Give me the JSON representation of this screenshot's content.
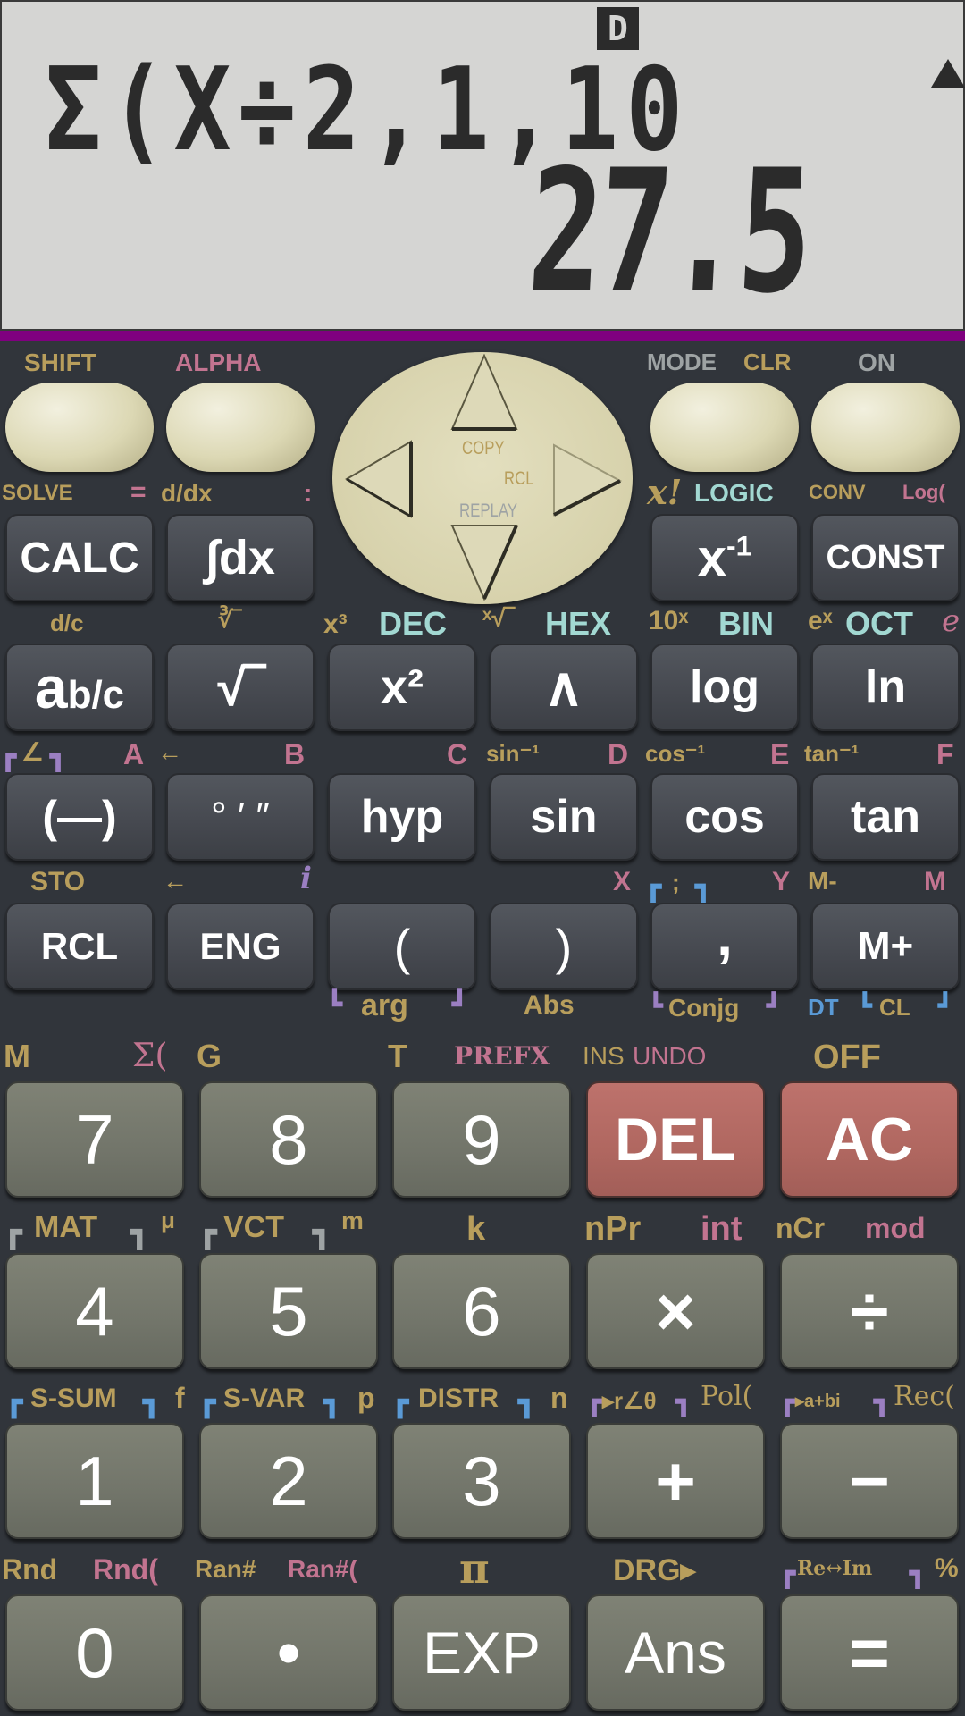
{
  "display": {
    "angle_mode_indicator": "D",
    "scroll_indicator": "up-triangle-icon",
    "expression": "Σ(X÷2,1,10",
    "result": "27.5"
  },
  "colors": {
    "body": "#31353b",
    "display_bg": "#d5d5d3",
    "display_border_bar": "#7f007f",
    "shift_label": "#b89e5c",
    "alpha_label": "#c27490",
    "mode_label": "#9ea3a4",
    "base_n_label": "#a2d8d2",
    "stat_bracket": "#5a9ad6",
    "complex_bracket": "#9b7fc2",
    "function_key": "#4a4d54",
    "number_key": "#74776b",
    "red_key": "#b06760"
  },
  "top_row": {
    "shift": {
      "label": "SHIFT"
    },
    "alpha": {
      "label": "ALPHA"
    },
    "mode": {
      "label": "MODE",
      "shift_label": "CLR"
    },
    "on": {
      "label": "ON"
    },
    "dpad": {
      "copy": "COPY",
      "rcl": "RCL",
      "replay": "REPLAY"
    }
  },
  "row2": {
    "labels": {
      "solve": "SOLVE",
      "eq": "=",
      "ddx": "d/dx",
      "colon": ":",
      "xfact": "x!",
      "logic": "LOGIC",
      "conv": "CONV",
      "logb": "Log("
    },
    "keys": {
      "calc": "CALC",
      "integral": "∫dx",
      "inverse": "x",
      "inverse_sup": "-1",
      "const": "CONST"
    }
  },
  "row3": {
    "labels": {
      "dc": "d/c",
      "cbrt": "∛‾",
      "x3": "x³",
      "dec": "DEC",
      "xroot": "ˣ√‾",
      "hex": "HEX",
      "tenx": "10ˣ",
      "bin": "BIN",
      "ex": "eˣ",
      "oct": "OCT",
      "e": "e"
    },
    "keys": {
      "frac": "ab/c",
      "frac_a": "a",
      "frac_bc": "b/c",
      "sqrt": "√‾",
      "square": "x²",
      "power": "∧",
      "log": "log",
      "ln": "ln"
    }
  },
  "row4": {
    "labels": {
      "angle": "∠",
      "A": "A",
      "left_arrow": "←",
      "B": "B",
      "C": "C",
      "asin": "sin⁻¹",
      "D": "D",
      "acos": "cos⁻¹",
      "E": "E",
      "atan": "tan⁻¹",
      "F": "F"
    },
    "keys": {
      "neg": "(—)",
      "dms": "° ′ ″",
      "hyp": "hyp",
      "sin": "sin",
      "cos": "cos",
      "tan": "tan"
    }
  },
  "row5": {
    "labels": {
      "sto": "STO",
      "left_arrow": "←",
      "i": "i",
      "X": "X",
      "semicolon": ";",
      "Y": "Y",
      "mminus": "M-",
      "M": "M",
      "arg": "arg",
      "abs": "Abs",
      "conjg": "Conjg",
      "dt": "DT",
      "cl": "CL"
    },
    "keys": {
      "rcl": "RCL",
      "eng": "ENG",
      "lparen": "(",
      "rparen": ")",
      "comma": ",",
      "mplus": "M+"
    }
  },
  "row6": {
    "labels": {
      "M": "M",
      "sigma": "Σ(",
      "G": "G",
      "T": "T",
      "prefx": "PREFX",
      "ins": "INS",
      "undo": "UNDO",
      "off": "OFF"
    },
    "keys": [
      "7",
      "8",
      "9",
      "DEL",
      "AC"
    ]
  },
  "row7": {
    "labels": {
      "mat": "MAT",
      "mu": "μ",
      "vct": "VCT",
      "m": "m",
      "k": "k",
      "npr": "nPr",
      "int": "int",
      "ncr": "nCr",
      "mod": "mod"
    },
    "keys": [
      "4",
      "5",
      "6",
      "×",
      "÷"
    ]
  },
  "row8": {
    "labels": {
      "ssum": "S-SUM",
      "f": "f",
      "svar": "S-VAR",
      "p": "p",
      "distr": "DISTR",
      "n": "n",
      "polar": "▸r∠θ",
      "pol": "Pol(",
      "rect": "▸a+bi",
      "rec": "Rec("
    },
    "keys": [
      "1",
      "2",
      "3",
      "+",
      "−"
    ]
  },
  "row9": {
    "labels": {
      "rnd": "Rnd",
      "rndf": "Rnd(",
      "ran": "Ran#",
      "ranf": "Ran#(",
      "pi": "π",
      "drg": "DRG▸",
      "reim": "Re↔Im",
      "pct": "%"
    },
    "keys": [
      "0",
      "•",
      "EXP",
      "Ans",
      "="
    ]
  }
}
